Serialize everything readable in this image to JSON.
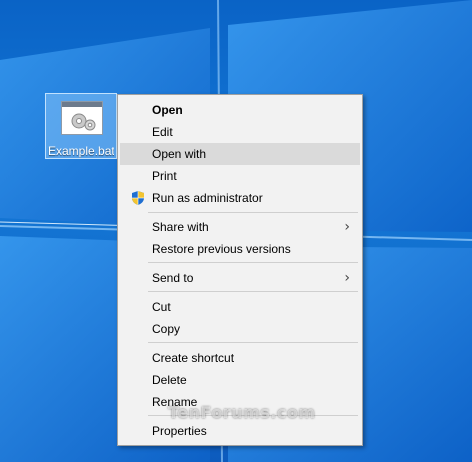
{
  "desktop": {
    "file_icon": {
      "label": "Example.bat",
      "icon": "batch-file-gears-icon"
    }
  },
  "context_menu": {
    "items": [
      {
        "label": "Open",
        "bold": true
      },
      {
        "label": "Edit"
      },
      {
        "label": "Open with",
        "highlighted": true
      },
      {
        "label": "Print"
      },
      {
        "label": "Run as administrator",
        "icon": "uac-shield-icon"
      },
      {
        "label": "Share with",
        "submenu": true
      },
      {
        "label": "Restore previous versions"
      },
      {
        "label": "Send to",
        "submenu": true
      },
      {
        "label": "Cut"
      },
      {
        "label": "Copy"
      },
      {
        "label": "Create shortcut"
      },
      {
        "label": "Delete"
      },
      {
        "label": "Rename"
      },
      {
        "label": "Properties"
      }
    ],
    "submenu_glyph": "›"
  },
  "watermark": {
    "text": "TenForums.com"
  },
  "colors": {
    "desktop_blue": "#0a63c6",
    "menu_bg": "#f2f2f2",
    "menu_hover": "#dadada",
    "selection": "#99d1ff"
  }
}
